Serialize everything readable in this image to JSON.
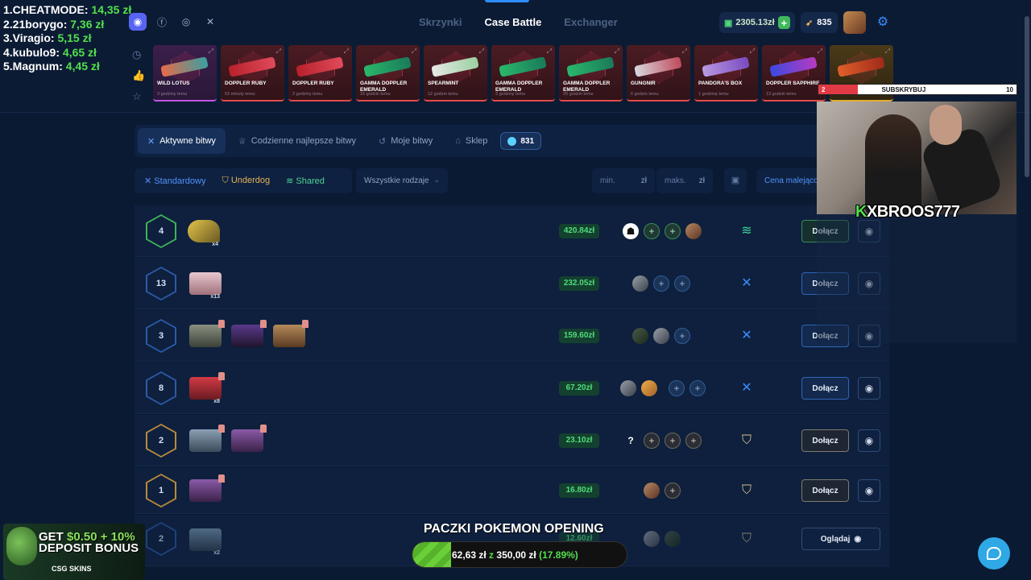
{
  "leaderboard": [
    {
      "rank_name": "1.CHEATMODE:",
      "value": "14,35 zł"
    },
    {
      "rank_name": "2.21borygo:",
      "value": "7,36 zł"
    },
    {
      "rank_name": "3.Viragio:",
      "value": "5,15 zł"
    },
    {
      "rank_name": "4.kubulo9:",
      "value": "4,65 zł"
    },
    {
      "rank_name": "5.Magnum:",
      "value": "4,45 zł"
    }
  ],
  "nav": {
    "items": [
      "Skrzynki",
      "Case Battle",
      "Exchanger"
    ],
    "active": "Case Battle"
  },
  "wallet": {
    "balance": "2305.13zł",
    "coins": "835"
  },
  "recent_drops": [
    {
      "name": "WILD LOTUS",
      "time": "3 godziny temu",
      "rarity": "pink"
    },
    {
      "name": "DOPPLER RUBY",
      "time": "53 minuty temu",
      "rarity": "red"
    },
    {
      "name": "DOPPLER RUBY",
      "time": "2 godziny temu",
      "rarity": "red"
    },
    {
      "name": "GAMMA DOPPLER EMERALD",
      "time": "16 godzin temu",
      "rarity": "red"
    },
    {
      "name": "SPEARMINT",
      "time": "12 godzin temu",
      "rarity": "red"
    },
    {
      "name": "GAMMA DOPPLER EMERALD",
      "time": "3 godziny temu",
      "rarity": "red"
    },
    {
      "name": "GAMMA DOPPLER EMERALD",
      "time": "20 godzin temu",
      "rarity": "red"
    },
    {
      "name": "GUNGNIR",
      "time": "6 godzin temu",
      "rarity": "red"
    },
    {
      "name": "PANDORA'S BOX",
      "time": "1 godzinę temu",
      "rarity": "red"
    },
    {
      "name": "DOPPLER SAPPHIRE",
      "time": "13 godzin temu",
      "rarity": "red"
    },
    {
      "name": "",
      "time": "",
      "rarity": "gold"
    }
  ],
  "subscribe": {
    "current": "2",
    "label": "SUBSKRYBUJ",
    "goal": "10",
    "progress": 0.2
  },
  "streamer_tag": {
    "k": "K",
    "name": "XBROOS777"
  },
  "tabs": [
    {
      "label": "Aktywne bitwy",
      "icon": "swords-icon",
      "active": true
    },
    {
      "label": "Codzienne najlepsze bitwy",
      "icon": "trophy-icon"
    },
    {
      "label": "Moje bitwy",
      "icon": "history-icon"
    },
    {
      "label": "Sklep",
      "icon": "shop-icon"
    }
  ],
  "battle_count": "831",
  "filters": {
    "modes": [
      "Standardowy",
      "Underdog",
      "Shared"
    ],
    "type_select": "Wszystkie rodzaje",
    "min_placeholder": "min.",
    "max_placeholder": "maks.",
    "currency": "zł",
    "sort": "Cena malejąco"
  },
  "battles": [
    {
      "rounds": "4",
      "price": "420.84zł",
      "action": "Dołącz",
      "mode": "shared",
      "case_mult": "x4"
    },
    {
      "rounds": "13",
      "price": "232.05zł",
      "action": "Dołącz",
      "mode": "standard",
      "case_mult": "x13"
    },
    {
      "rounds": "3",
      "price": "159.60zł",
      "action": "Dołącz",
      "mode": "standard",
      "case_mult": ""
    },
    {
      "rounds": "8",
      "price": "67.20zł",
      "action": "Dołącz",
      "mode": "standard",
      "case_mult": "x8"
    },
    {
      "rounds": "2",
      "price": "23.10zł",
      "action": "Dołącz",
      "mode": "underdog",
      "case_mult": ""
    },
    {
      "rounds": "1",
      "price": "16.80zł",
      "action": "Dołącz",
      "mode": "underdog",
      "case_mult": ""
    },
    {
      "rounds": "2",
      "price": "12.60zł",
      "action": "Oglądaj",
      "mode": "underdog",
      "case_mult": "x2"
    }
  ],
  "promo": {
    "line1a": "GET ",
    "line1b": "$0.50",
    "line1c": " + 10%",
    "line2": "DEPOSIT BONUS",
    "brand": "CSG SKINS"
  },
  "goal_overlay": {
    "title": "PACZKI POKEMON OPENING",
    "current": "62,63 zł",
    "of": "z",
    "target": "350,00 zł",
    "percent": "(17.89%)",
    "progress": 0.1789
  },
  "colors": {
    "accent": "#2f8cff",
    "price_green": "#4fdc7a",
    "background": "#0b1a33"
  }
}
